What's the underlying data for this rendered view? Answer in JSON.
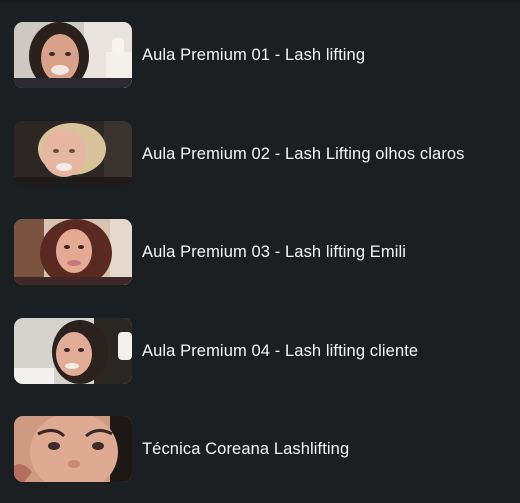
{
  "lessons": [
    {
      "title": "Aula Premium 01 - Lash lifting",
      "thumbnail": "video-thumbnail"
    },
    {
      "title": "Aula Premium 02 - Lash Lifting olhos claros",
      "thumbnail": "video-thumbnail"
    },
    {
      "title": "Aula Premium 03 - Lash lifting Emili",
      "thumbnail": "video-thumbnail"
    },
    {
      "title": "Aula Premium 04 - Lash lifting cliente",
      "thumbnail": "video-thumbnail"
    },
    {
      "title": "Técnica Coreana Lashlifting",
      "thumbnail": "video-thumbnail"
    }
  ],
  "colors": {
    "background": "#1c1f22",
    "text": "#f4f5f6"
  }
}
